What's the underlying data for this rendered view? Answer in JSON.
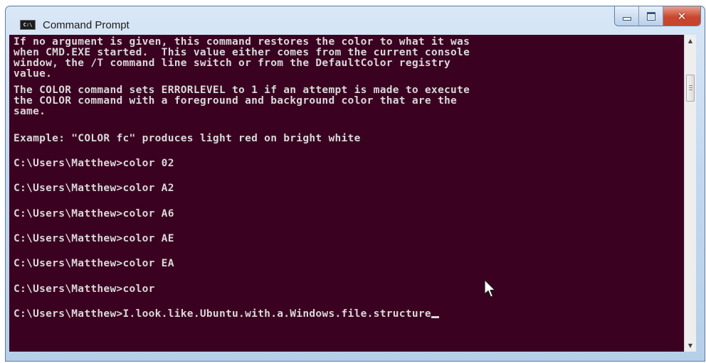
{
  "window": {
    "title": "Command Prompt",
    "app_icon_text": "C:\\",
    "background_color": "#3b0121",
    "text_color": "#d9d9d9"
  },
  "console": {
    "lines": [
      "If no argument is given, this command restores the color to what it was",
      "when CMD.EXE started.  This value either comes from the current console",
      "window, the /T command line switch or from the DefaultColor registry",
      "value.",
      "The COLOR command sets ERRORLEVEL to 1 if an attempt is made to execute",
      "the COLOR command with a foreground and background color that are the",
      "same.",
      "Example: \"COLOR fc\" produces light red on bright white",
      "C:\\Users\\Matthew>color 02",
      "C:\\Users\\Matthew>color A2",
      "C:\\Users\\Matthew>color A6",
      "C:\\Users\\Matthew>color AE",
      "C:\\Users\\Matthew>color EA",
      "C:\\Users\\Matthew>color",
      "C:\\Users\\Matthew>I.look.like.Ubuntu.with.a.Windows.file.structure"
    ]
  },
  "icons": {
    "app": "console-app-icon",
    "minimize": "minimize-icon",
    "maximize": "maximize-icon",
    "close": "close-icon",
    "scroll_up": "scroll-up-arrow-icon",
    "scroll_down": "scroll-down-arrow-icon",
    "pointer": "mouse-pointer-icon"
  }
}
